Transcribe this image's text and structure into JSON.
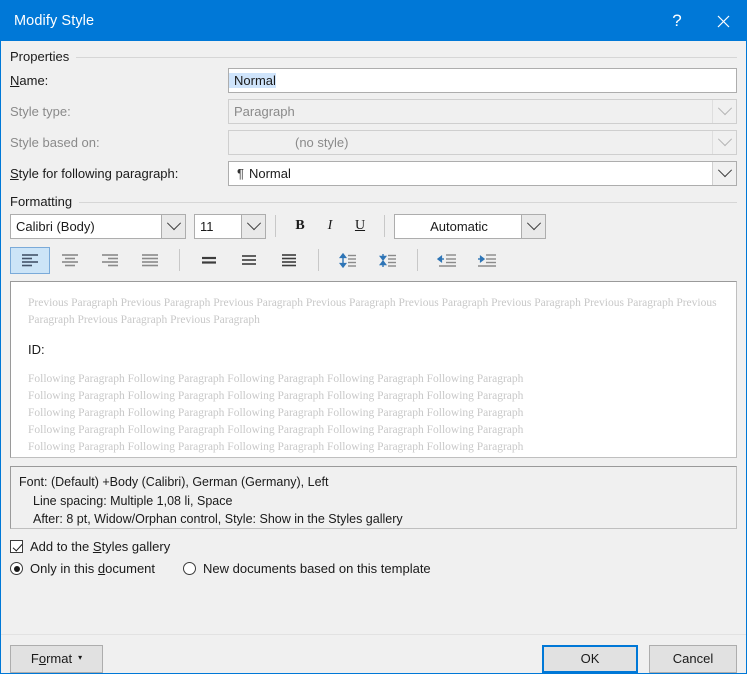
{
  "window": {
    "title": "Modify Style",
    "help_label": "?",
    "close_label": "✕"
  },
  "properties": {
    "group_label": "Properties",
    "name": {
      "label_pre": "N",
      "label_post": "ame:",
      "value": "Normal"
    },
    "style_type": {
      "label": "Style type:",
      "value": "Paragraph"
    },
    "style_based_on": {
      "label": "Style based on:",
      "value": "(no style)"
    },
    "following_paragraph": {
      "label_pre": "S",
      "label_post": "tyle for following paragraph:",
      "icon": "¶",
      "value": "Normal"
    }
  },
  "formatting": {
    "group_label": "Formatting",
    "font_family": "Calibri (Body)",
    "font_size": "11",
    "bold_label": "B",
    "italic_label": "I",
    "underline_label": "U",
    "font_color": "Automatic",
    "buttons": {
      "align_left": "align-left",
      "align_center": "align-center",
      "align_right": "align-right",
      "justify": "justify",
      "line_spacing_1": "line-spacing-single",
      "line_spacing_15": "line-spacing-1.5",
      "line_spacing_2": "line-spacing-double",
      "increase_spacing": "increase-paragraph-spacing",
      "decrease_spacing": "decrease-paragraph-spacing",
      "decrease_indent": "decrease-indent",
      "increase_indent": "increase-indent"
    }
  },
  "preview": {
    "previous_paragraph": "Previous Paragraph Previous Paragraph Previous Paragraph Previous Paragraph Previous Paragraph Previous Paragraph Previous Paragraph Previous Paragraph Previous Paragraph Previous Paragraph",
    "sample_text": "ID:",
    "following_line": "Following Paragraph Following Paragraph Following Paragraph Following Paragraph Following Paragraph",
    "following_lines": [
      "Following Paragraph Following Paragraph Following Paragraph Following Paragraph Following Paragraph",
      "Following Paragraph Following Paragraph Following Paragraph Following Paragraph Following Paragraph",
      "Following Paragraph Following Paragraph Following Paragraph Following Paragraph Following Paragraph",
      "Following Paragraph Following Paragraph Following Paragraph Following Paragraph Following Paragraph",
      "Following Paragraph Following Paragraph Following Paragraph Following Paragraph Following Paragraph"
    ]
  },
  "description": {
    "line1": "Font: (Default) +Body (Calibri), German (Germany), Left",
    "line2": "Line spacing:  Multiple 1,08 li, Space",
    "line3": "After:  8 pt, Widow/Orphan control, Style: Show in the Styles gallery"
  },
  "options": {
    "add_to_gallery": {
      "pre": "Add to the ",
      "acc": "S",
      "post": "tyles gallery",
      "checked": true
    },
    "only_this_document": {
      "pre": "Only in this ",
      "acc": "d",
      "post": "ocument",
      "checked": true
    },
    "new_documents": {
      "label": "New documents based on this template",
      "checked": false
    }
  },
  "footer": {
    "format_pre": "F",
    "format_acc": "o",
    "format_post": "rmat",
    "format_caret": "▾",
    "ok_label": "OK",
    "cancel_label": "Cancel"
  },
  "colors": {
    "title_bar": "#0078d7",
    "dialog_background": "#f0f0f0",
    "focus_border": "#0078d7",
    "selection_highlight": "#cfe4fb"
  }
}
